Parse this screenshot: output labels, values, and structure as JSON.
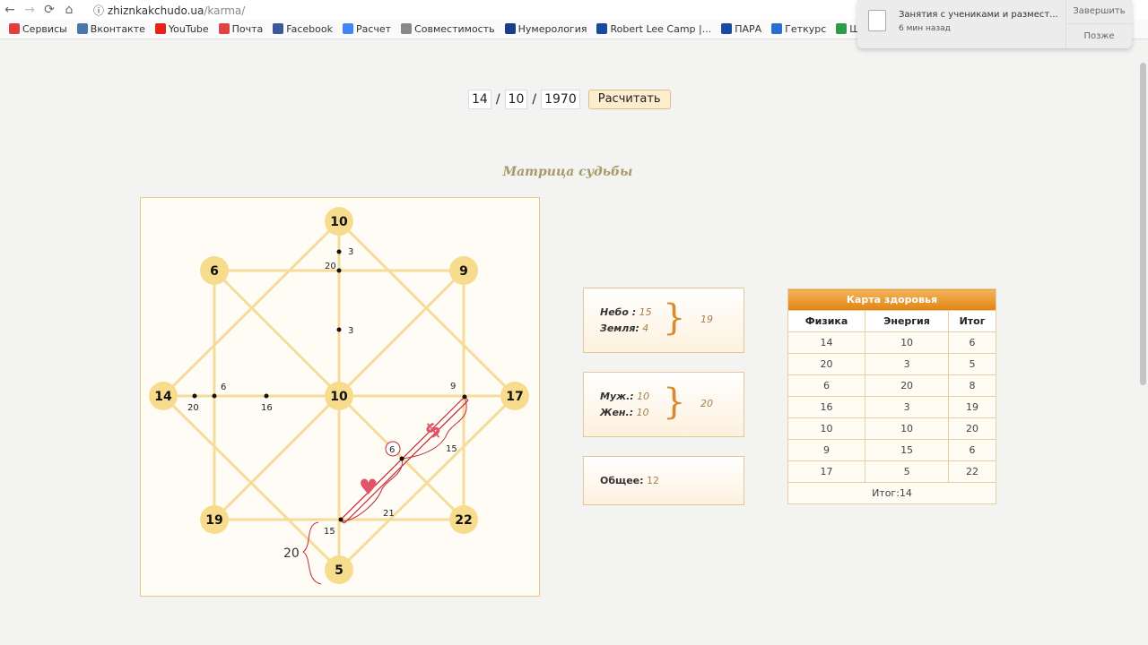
{
  "browser": {
    "url_host": "zhiznkakchudo.ua",
    "url_path": "/karma/",
    "bookmarks": [
      {
        "label": "Сервисы",
        "color": "#e0403a"
      },
      {
        "label": "Вконтакте",
        "color": "#4a76a8"
      },
      {
        "label": "YouTube",
        "color": "#e62117"
      },
      {
        "label": "Почта",
        "color": "#d44"
      },
      {
        "label": "Facebook",
        "color": "#3b5998"
      },
      {
        "label": "Расчет",
        "color": "#4285f4"
      },
      {
        "label": "Совместимость",
        "color": "#888"
      },
      {
        "label": "Нумерология",
        "color": "#1a3c8a"
      },
      {
        "label": "Robert Lee Camp |...",
        "color": "#1a4aa0"
      },
      {
        "label": "ПАРА",
        "color": "#1a4aa0"
      },
      {
        "label": "Геткурс",
        "color": "#2a6fd0"
      },
      {
        "label": "Ш",
        "color": "#2e9a4a"
      }
    ]
  },
  "notification": {
    "title": "Занятия с учениками и размест...",
    "time": "6 мин назад",
    "finish": "Завершить",
    "later": "Позже"
  },
  "form": {
    "day": "14",
    "month": "10",
    "year": "1970",
    "sep": "/",
    "button": "Расчитать"
  },
  "heading": "Матрица судьбы",
  "matrix": {
    "nodes": {
      "top": "10",
      "top_left": "6",
      "top_right": "9",
      "left": "14",
      "center": "10",
      "right": "17",
      "bottom_left": "19",
      "bottom_right": "22",
      "bottom": "5"
    },
    "points": {
      "top_a": "3",
      "top_b": "20",
      "mid_top": "3",
      "left_a": "20",
      "left_b": "6",
      "left_c": "16",
      "right_a": "9",
      "diag_circle": "6",
      "diag_money": "15",
      "diag_love": "21",
      "bottom_a": "15"
    },
    "annotation_brace": "20"
  },
  "boxes": {
    "sky_label": "Небо :",
    "sky": "15",
    "earth_label": "Земля:",
    "earth": "4",
    "sum1": "19",
    "male_label": "Муж.:",
    "male": "10",
    "female_label": "Жен.:",
    "female": "10",
    "sum2": "20",
    "general_label": "Общее:",
    "general": "12"
  },
  "health": {
    "caption": "Карта здоровья",
    "headers": [
      "Физика",
      "Энергия",
      "Итог"
    ],
    "rows": [
      [
        "14",
        "10",
        "6"
      ],
      [
        "20",
        "3",
        "5"
      ],
      [
        "6",
        "20",
        "8"
      ],
      [
        "16",
        "3",
        "19"
      ],
      [
        "10",
        "10",
        "20"
      ],
      [
        "9",
        "15",
        "6"
      ],
      [
        "17",
        "5",
        "22"
      ]
    ],
    "total": "Итог:14"
  }
}
